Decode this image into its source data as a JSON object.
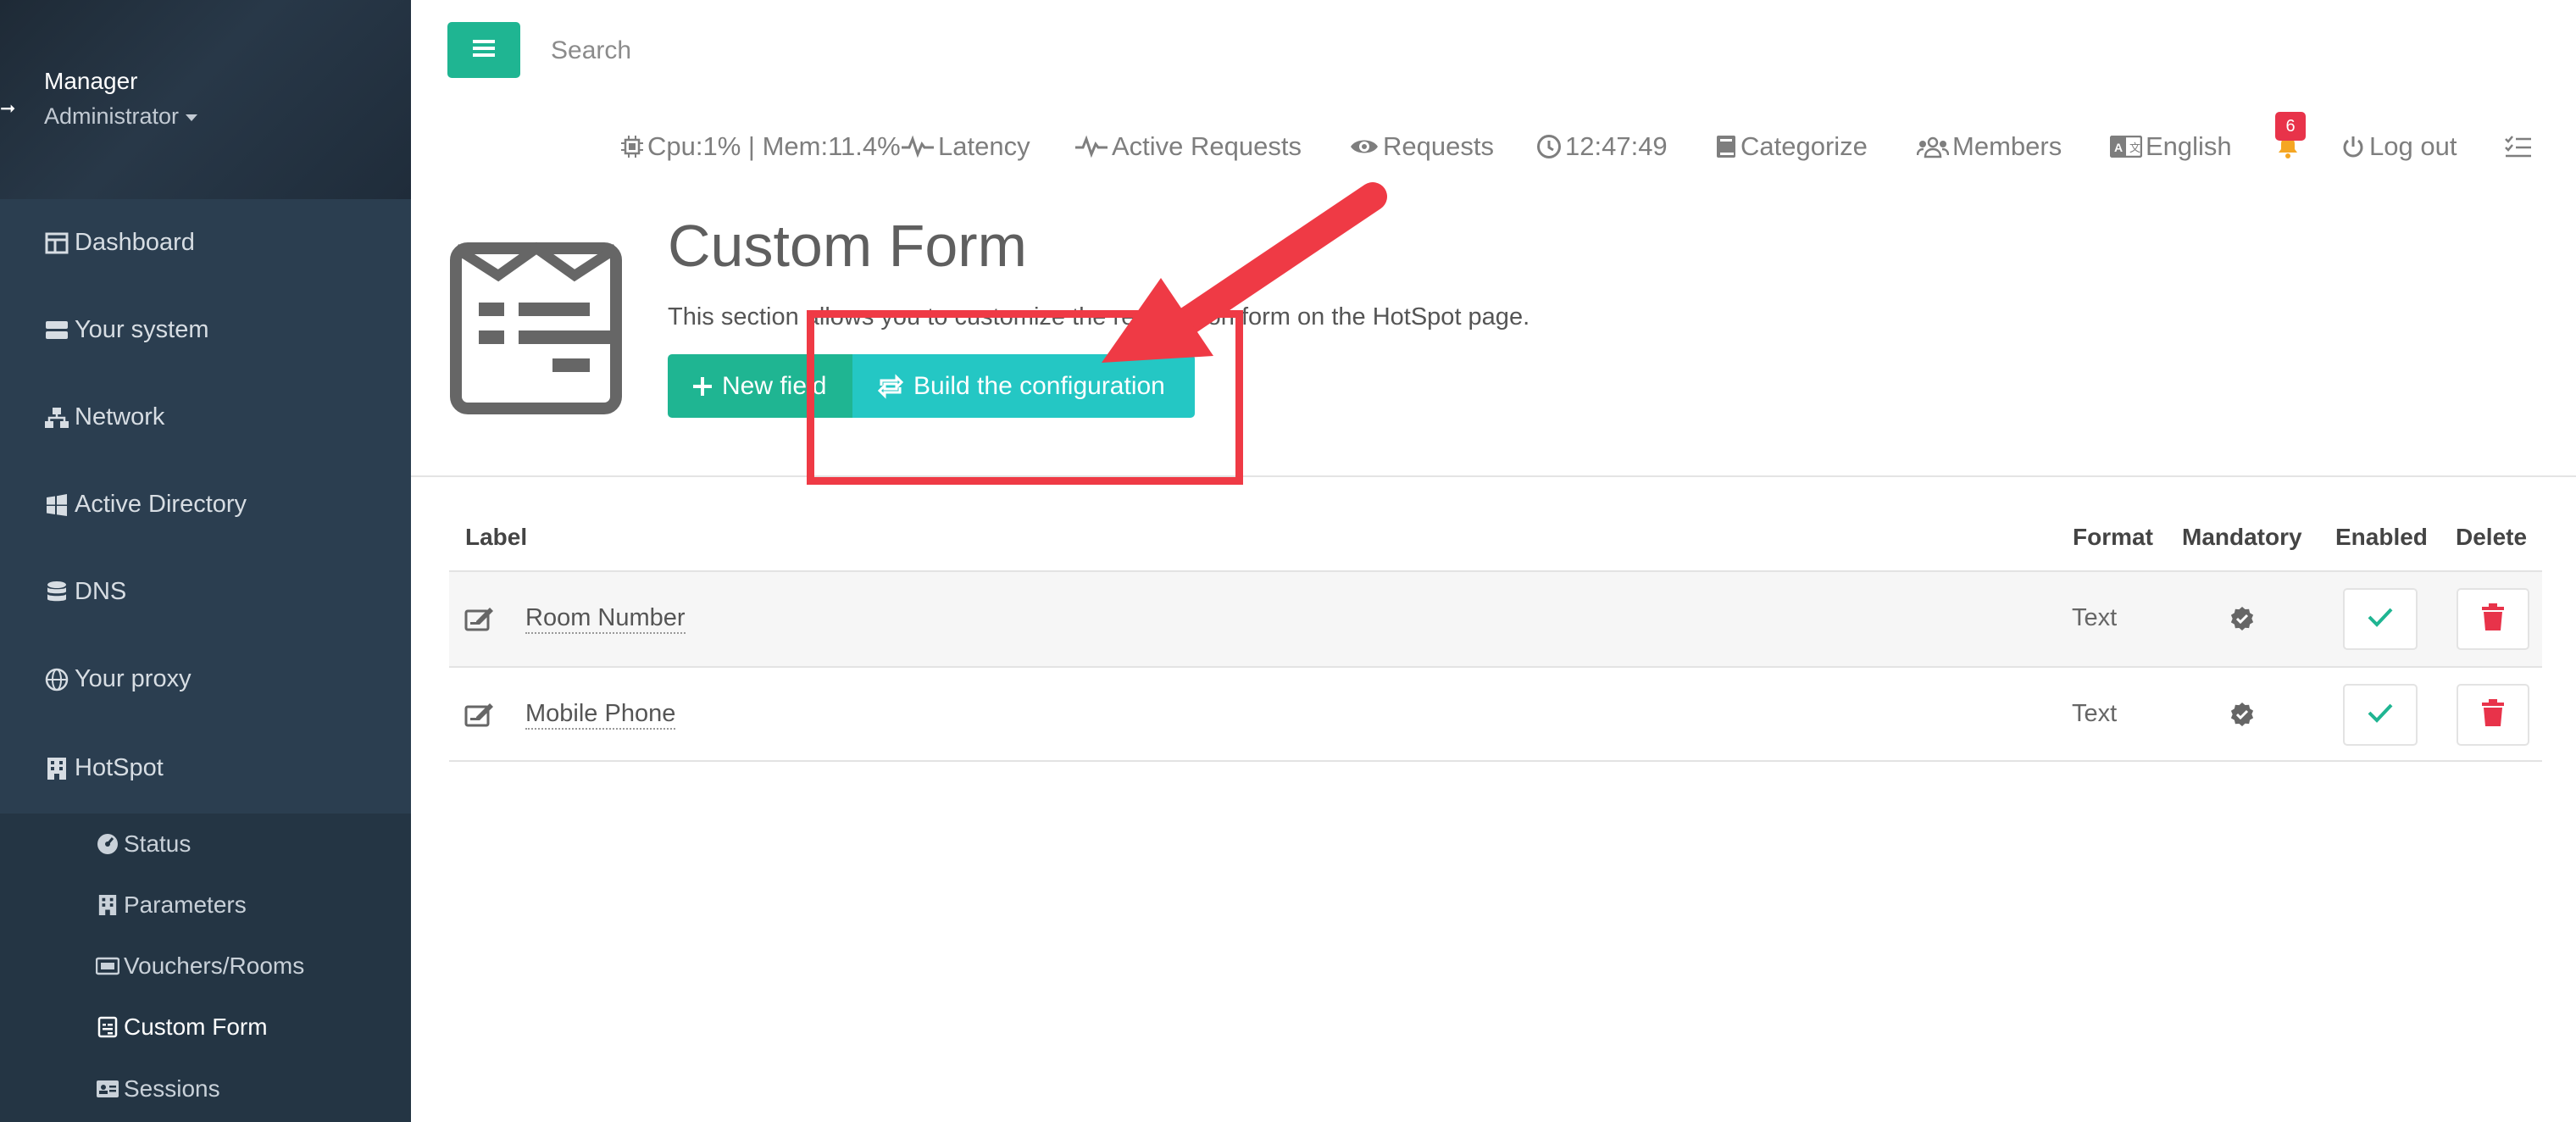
{
  "sidebar": {
    "profile": {
      "name": "Manager",
      "role": "Administrator"
    },
    "items": [
      {
        "label": "Dashboard",
        "icon": "dashboard-icon"
      },
      {
        "label": "Your system",
        "icon": "server-icon"
      },
      {
        "label": "Network",
        "icon": "network-icon"
      },
      {
        "label": "Active Directory",
        "icon": "windows-icon"
      },
      {
        "label": "DNS",
        "icon": "database-icon"
      },
      {
        "label": "Your proxy",
        "icon": "globe-icon"
      },
      {
        "label": "HotSpot",
        "icon": "building-icon"
      }
    ],
    "subitems": [
      {
        "label": "Status",
        "icon": "gauge-icon"
      },
      {
        "label": "Parameters",
        "icon": "building-icon"
      },
      {
        "label": "Vouchers/Rooms",
        "icon": "ticket-icon"
      },
      {
        "label": "Custom Form",
        "icon": "form-icon",
        "active": true
      },
      {
        "label": "Sessions",
        "icon": "id-card-icon"
      }
    ]
  },
  "topbar": {
    "search_placeholder": "Search",
    "nav": {
      "cpu_mem": "Cpu:1% | Mem:11.4%",
      "latency": "Latency",
      "active_requests": "Active Requests",
      "requests": "Requests",
      "clock": "12:47:49",
      "categorize": "Categorize",
      "members": "Members",
      "language": "English",
      "notifications_count": "6",
      "logout": "Log out"
    }
  },
  "page": {
    "title": "Custom Form",
    "description": "This section allows you to customize the registration form on the HotSpot page.",
    "new_field_label": "New field",
    "build_label": "Build the configuration"
  },
  "table": {
    "headers": {
      "label": "Label",
      "format": "Format",
      "mandatory": "Mandatory",
      "enabled": "Enabled",
      "delete": "Delete"
    },
    "rows": [
      {
        "label": "Room Number",
        "format": "Text",
        "mandatory": true,
        "enabled": true
      },
      {
        "label": "Mobile Phone",
        "format": "Text",
        "mandatory": true,
        "enabled": true
      }
    ]
  },
  "colors": {
    "sidebar": "#2b3e50",
    "primary_green": "#1fb592",
    "teal": "#24c7c4",
    "danger": "#e8334a",
    "annotation": "#ef3a45"
  }
}
